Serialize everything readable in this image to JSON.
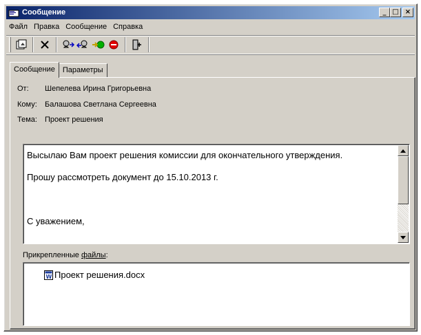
{
  "window": {
    "title": "Сообщение"
  },
  "title_buttons": {
    "minimize": "_",
    "maximize": "□",
    "close": "×"
  },
  "menu": [
    "Файл",
    "Правка",
    "Сообщение",
    "Справка"
  ],
  "toolbar": {
    "icons": [
      "send-receive-icon",
      "delete-icon",
      "reply-icon",
      "reply-all-icon",
      "forward-icon",
      "stop-icon",
      "exit-icon"
    ]
  },
  "tabs": [
    "Сообщение",
    "Параметры"
  ],
  "header": {
    "from_label": "От:",
    "from_value": "Шепелева Ирина Григорьевна",
    "to_label": "Кому:",
    "to_value": "Балашова Светлана Сергеевна",
    "subject_label": "Тема:",
    "subject_value": "Проект решения"
  },
  "body": {
    "lines": [
      "Высылаю Вам проект решения комиссии для окончательного утверждения.",
      "",
      "Прошу рассмотреть документ до 15.10.2013 г.",
      "",
      "",
      "",
      "С уважением,"
    ]
  },
  "attachments": {
    "label_prefix": "Прикрепленные ",
    "label_underlined": "файлы",
    "label_suffix": ":",
    "files": [
      "Проект решения.docx"
    ]
  },
  "colors": {
    "titlebar_start": "#0a246a",
    "titlebar_end": "#a6caf0",
    "face": "#d4d0c8"
  }
}
